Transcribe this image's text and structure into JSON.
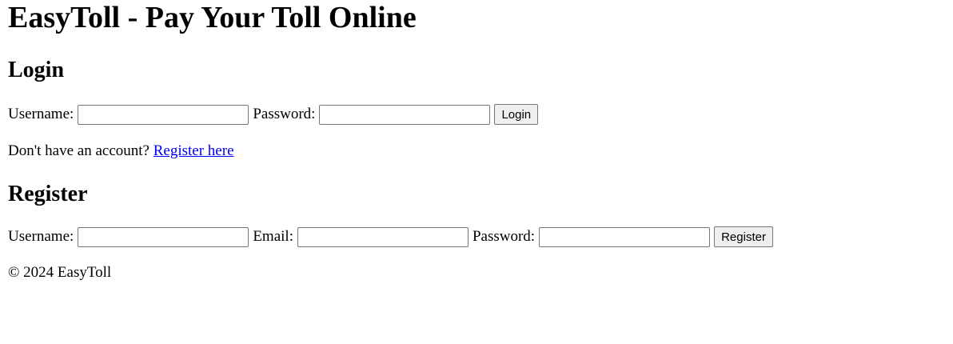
{
  "header": {
    "title": "EasyToll - Pay Your Toll Online"
  },
  "login": {
    "heading": "Login",
    "username_label": "Username:",
    "username_value": "",
    "password_label": "Password:",
    "password_value": "",
    "submit_label": "Login",
    "no_account_text": "Don't have an account?",
    "register_link_text": "Register here"
  },
  "register": {
    "heading": "Register",
    "username_label": "Username:",
    "username_value": "",
    "email_label": "Email:",
    "email_value": "",
    "password_label": "Password:",
    "password_value": "",
    "submit_label": "Register"
  },
  "footer": {
    "text": "© 2024 EasyToll"
  },
  "colors": {
    "link": "#0000ee",
    "button_bg": "#efefef",
    "input_border": "#767676"
  }
}
